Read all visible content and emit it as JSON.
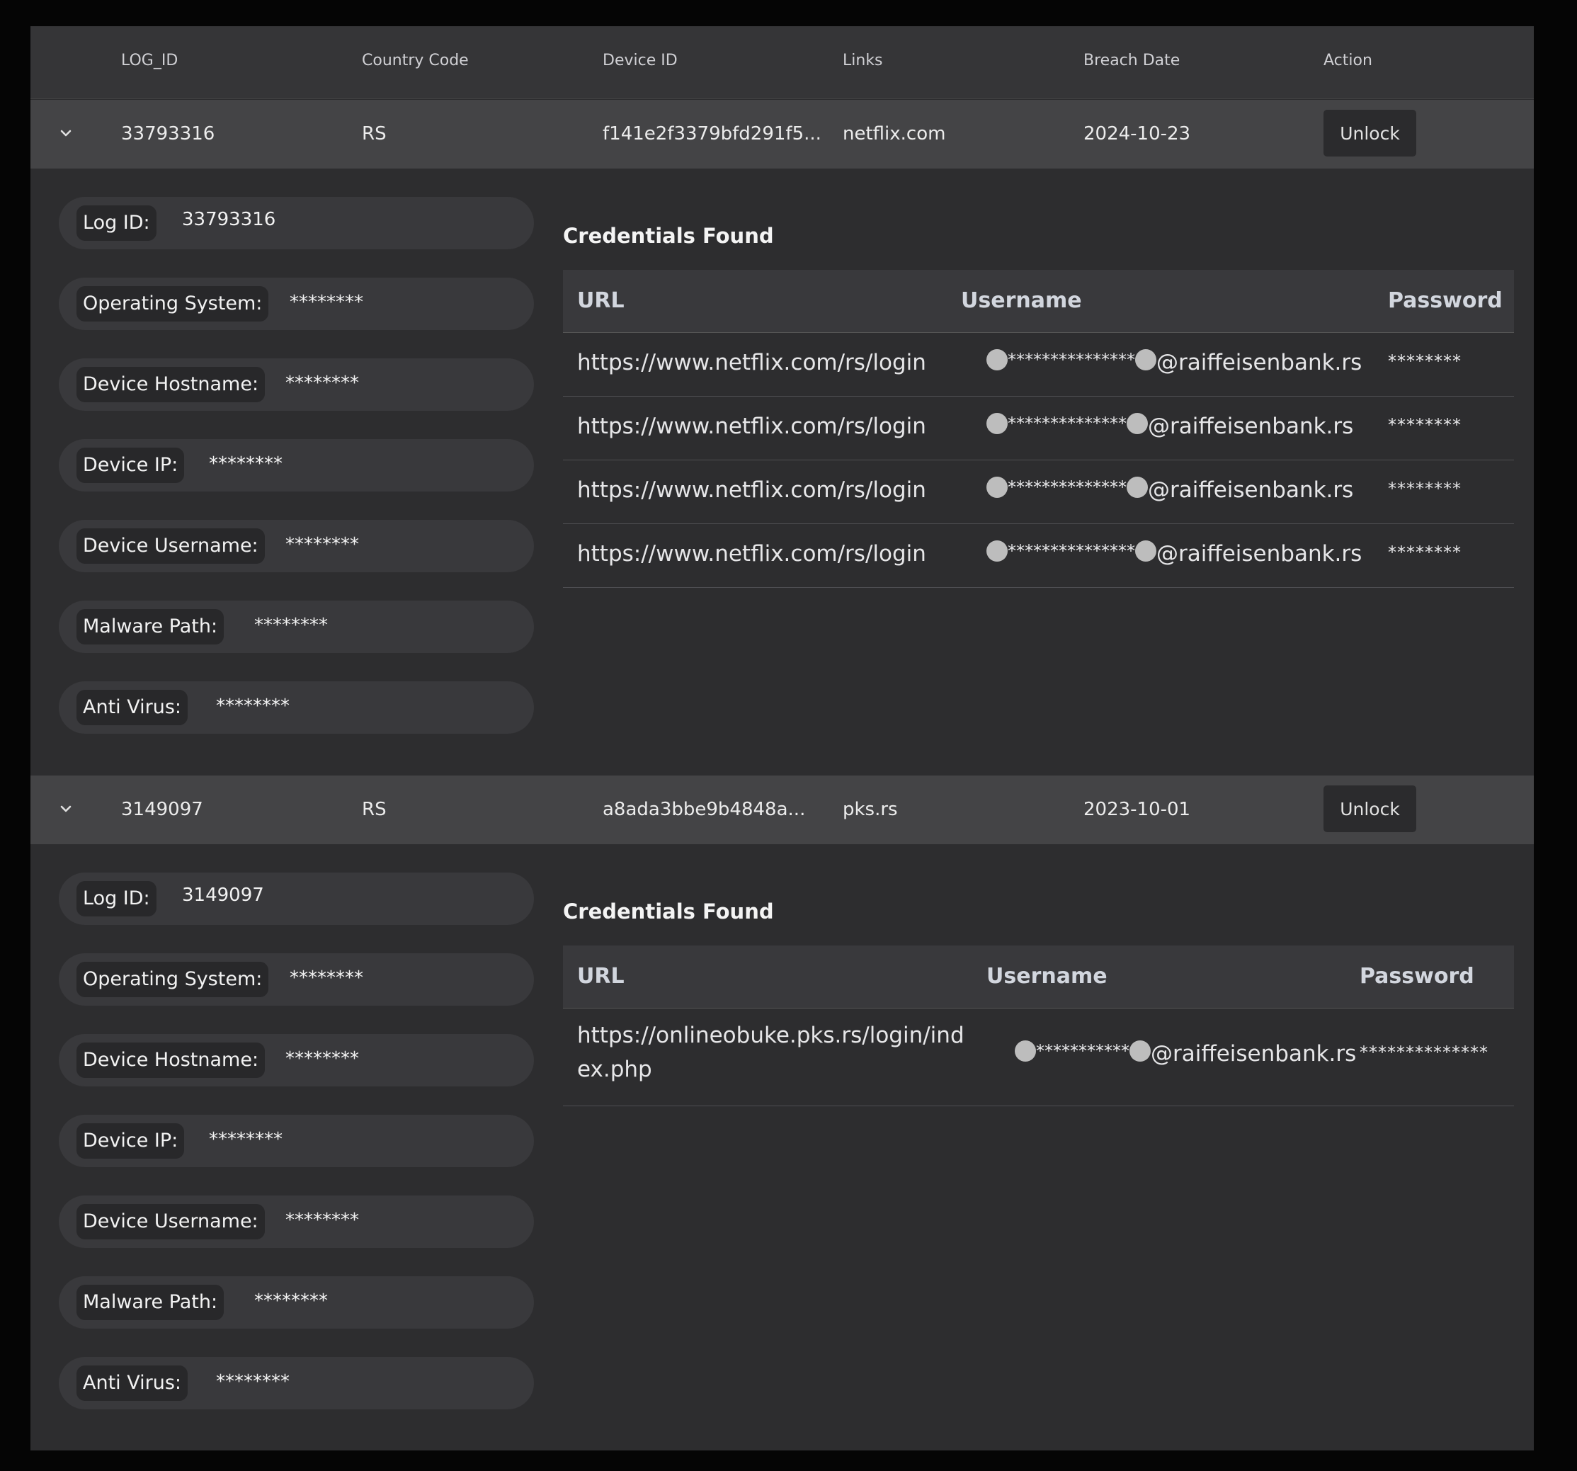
{
  "table": {
    "columns": [
      "LOG_ID",
      "Country Code",
      "Device ID",
      "Links",
      "Breach Date",
      "Action"
    ]
  },
  "records": [
    {
      "log_id": "33793316",
      "country_code": "RS",
      "device_id": "f141e2f3379bfd291f5...",
      "links": "netflix.com",
      "breach_date": "2024-10-23",
      "action_label": "Unlock",
      "details": [
        {
          "label": "Log ID:",
          "value": "33793316"
        },
        {
          "label": "Operating System:",
          "value": "********"
        },
        {
          "label": "Device Hostname:",
          "value": "********"
        },
        {
          "label": "Device IP:",
          "value": "********"
        },
        {
          "label": "Device Username:",
          "value": "********"
        },
        {
          "label": "Malware Path:",
          "value": "********"
        },
        {
          "label": "Anti Virus:",
          "value": "********"
        }
      ],
      "credentials_title": "Credentials Found",
      "cred_headers": [
        "URL",
        "Username",
        "Password"
      ],
      "credentials": [
        {
          "url": "https://www.netflix.com/rs/login",
          "username_mask": "***************",
          "username_domain": "@raiffeisenbank.rs",
          "password": "********"
        },
        {
          "url": "https://www.netflix.com/rs/login",
          "username_mask": "**************",
          "username_domain": "@raiffeisenbank.rs",
          "password": "********"
        },
        {
          "url": "https://www.netflix.com/rs/login",
          "username_mask": "**************",
          "username_domain": "@raiffeisenbank.rs",
          "password": "********"
        },
        {
          "url": "https://www.netflix.com/rs/login",
          "username_mask": "***************",
          "username_domain": "@raiffeisenbank.rs",
          "password": "********"
        }
      ]
    },
    {
      "log_id": "3149097",
      "country_code": "RS",
      "device_id": "a8ada3bbe9b4848a...",
      "links": "pks.rs",
      "breach_date": "2023-10-01",
      "action_label": "Unlock",
      "details": [
        {
          "label": "Log ID:",
          "value": "3149097"
        },
        {
          "label": "Operating System:",
          "value": "********"
        },
        {
          "label": "Device Hostname:",
          "value": "********"
        },
        {
          "label": "Device IP:",
          "value": "********"
        },
        {
          "label": "Device Username:",
          "value": "********"
        },
        {
          "label": "Malware Path:",
          "value": "********"
        },
        {
          "label": "Anti Virus:",
          "value": "********"
        }
      ],
      "credentials_title": "Credentials Found",
      "cred_headers": [
        "URL",
        "Username",
        "Password"
      ],
      "credentials": [
        {
          "url_line1": "https://onlineobuke.pks.rs/login/ind",
          "url_line2": "ex.php",
          "username_mask": "***********",
          "username_domain": "@raiffeisenbank.rs",
          "password": "**************"
        }
      ]
    }
  ]
}
